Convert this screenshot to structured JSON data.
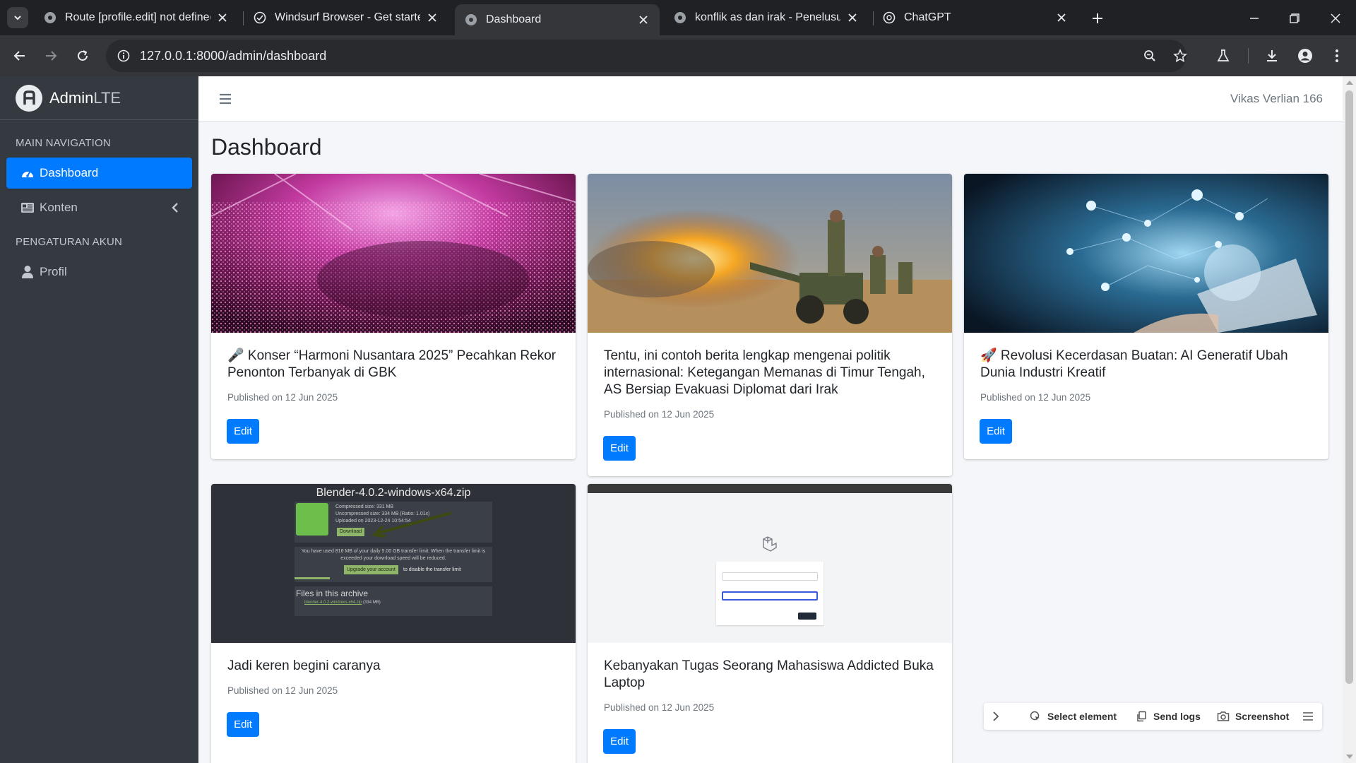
{
  "browser": {
    "tabs": [
      {
        "title": "Route [profile.edit] not defined.",
        "icon": "globe-icon"
      },
      {
        "title": "Windsurf Browser - Get started",
        "icon": "windsurf-icon"
      },
      {
        "title": "Dashboard",
        "icon": "globe-icon",
        "active": true
      },
      {
        "title": "konflik as dan irak - Penelusuran",
        "icon": "globe-icon"
      },
      {
        "title": "ChatGPT",
        "icon": "chatgpt-icon"
      }
    ],
    "url": "127.0.0.1:8000/admin/dashboard"
  },
  "sidebar": {
    "brand_main": "Admin",
    "brand_light": "LTE",
    "headers": [
      "MAIN NAVIGATION",
      "PENGATURAN AKUN"
    ],
    "items": [
      {
        "label": "Dashboard",
        "icon": "dashboard-gauge-icon",
        "active": true
      },
      {
        "label": "Konten",
        "icon": "newspaper-icon",
        "has_submenu": true
      },
      {
        "label": "Profil",
        "icon": "user-icon"
      }
    ]
  },
  "topbar": {
    "username": "Vikas Verlian 166"
  },
  "main": {
    "title": "Dashboard",
    "edit_label": "Edit",
    "posts": [
      {
        "title": "🎤 Konser “Harmoni Nusantara 2025” Pecahkan Rekor Penonton Terbanyak di GBK",
        "date": "Published on 12 Jun 2025",
        "image": "concert-crowd"
      },
      {
        "title": "Tentu, ini contoh berita lengkap mengenai politik internasional: Ketegangan Memanas di Timur Tengah, AS Bersiap Evakuasi Diplomat dari Irak",
        "date": "Published on 12 Jun 2025",
        "image": "artillery-soldiers"
      },
      {
        "title": "🚀 Revolusi Kecerdasan Buatan: AI Generatif Ubah Dunia Industri Kreatif",
        "date": "Published on 12 Jun 2025",
        "image": "ai-technology"
      },
      {
        "title": "Jadi keren begini caranya",
        "date": "Published on 12 Jun 2025",
        "image": "download-page-screenshot",
        "image_text": {
          "filename": "Blender-4.0.2-windows-x64.zip",
          "compressed": "Compressed size: 331 MB",
          "uncompressed": "Uncompressed size: 334 MB (Ratio: 1.01x)",
          "uploaded": "Uploaded on 2023-12-24 10:54:54",
          "download_btn": "Download",
          "limit_text": "You have used 816 MB of your daily 5.00 GB transfer limit. When the transfer limit is exceeded your download speed will be reduced.",
          "upgrade_btn": "Upgrade your account",
          "upgrade_suffix": "to disable the transfer limit",
          "files_heading": "Files in this archive",
          "file_entry": "blender-4.0.2-windows-x64.zip",
          "file_size": "(334 MB)"
        }
      },
      {
        "title": "Kebanyakan Tugas Seorang Mahasiswa Addicted Buka Laptop",
        "date": "Published on 12 Jun 2025",
        "image": "login-page-screenshot"
      }
    ]
  },
  "devbar": {
    "items": [
      "Select element",
      "Send logs",
      "Screenshot"
    ]
  },
  "colors": {
    "primary": "#007bff",
    "sidebar_bg": "#343a40",
    "content_bg": "#f4f6f9"
  }
}
